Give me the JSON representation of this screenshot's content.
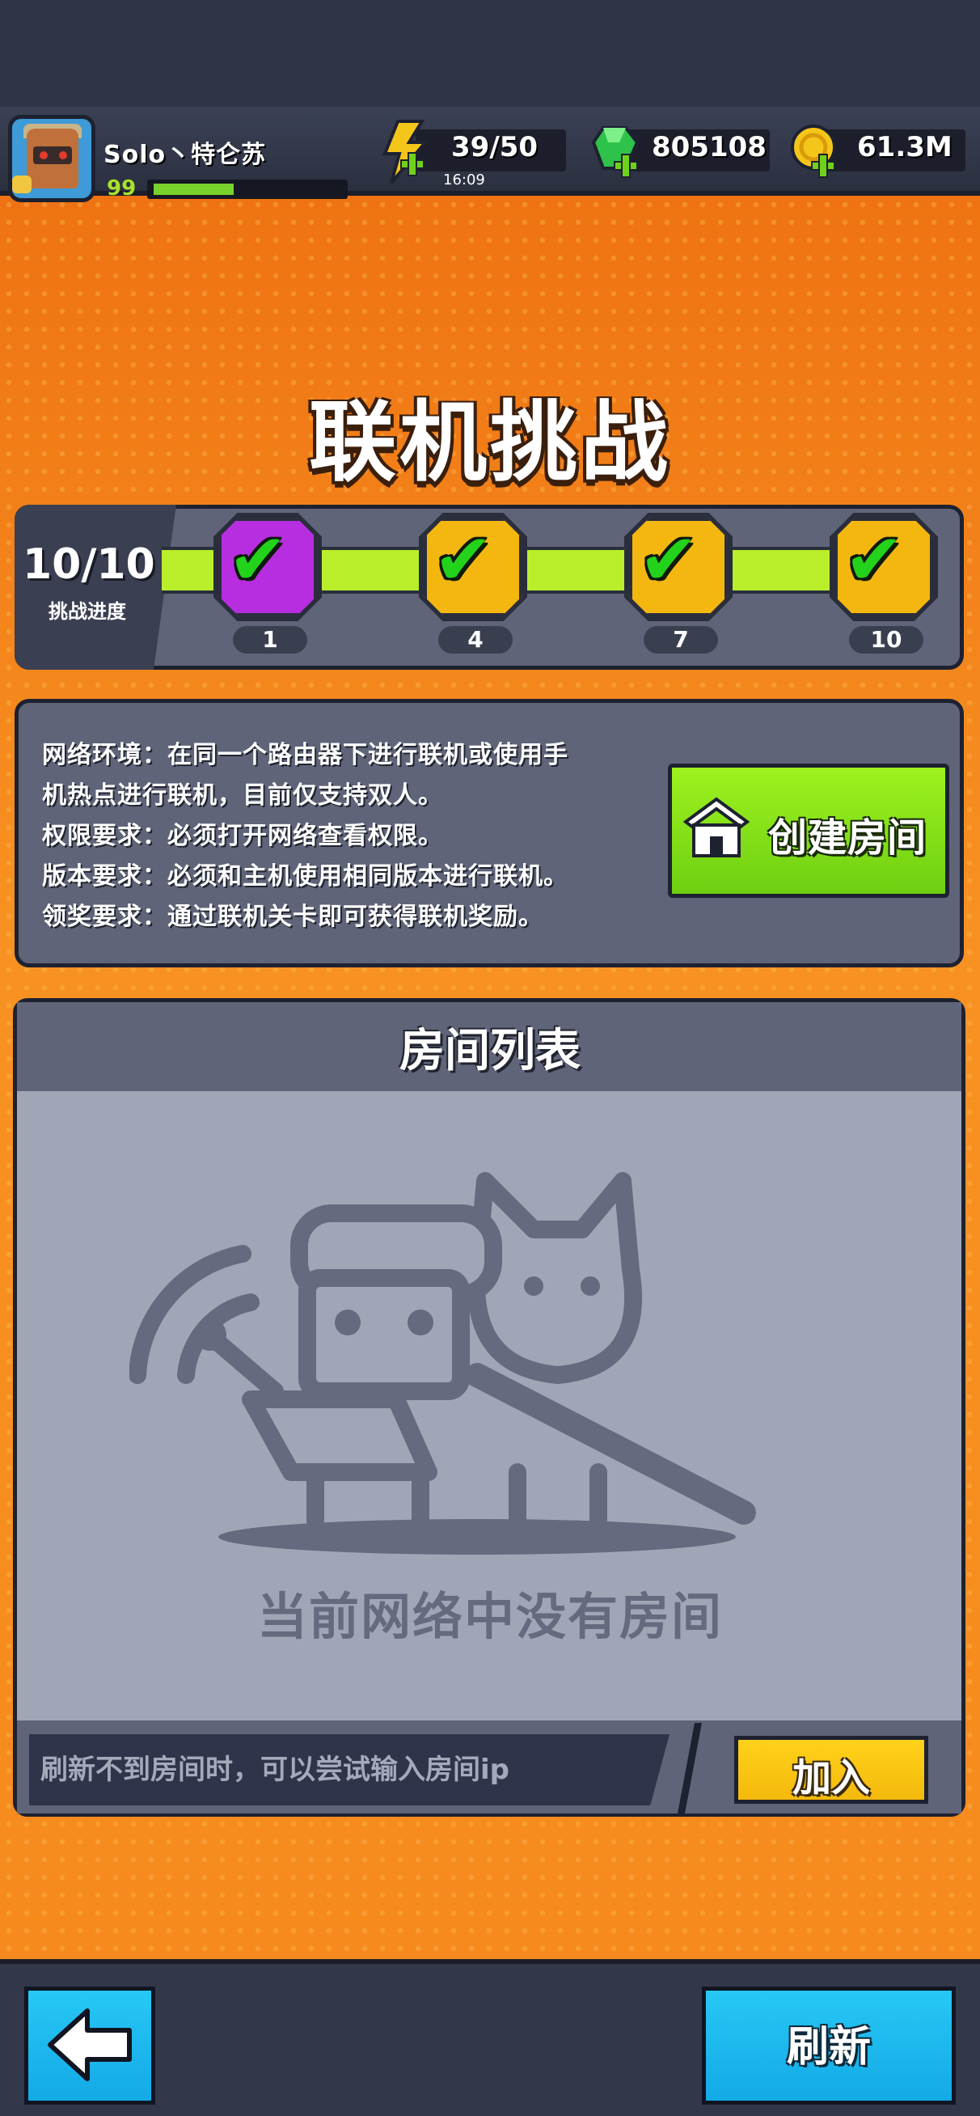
{
  "player": {
    "name": "Solo丶特仑苏",
    "level": "99",
    "xp_fraction": 0.42
  },
  "resources": {
    "energy": "39/50",
    "energy_timer": "16:09",
    "gems": "805108",
    "coins": "61.3M"
  },
  "page_title": "联机挑战",
  "challenge": {
    "count": "10/10",
    "label": "挑战进度",
    "milestones": [
      {
        "label": "1",
        "color": "#b72ee0"
      },
      {
        "label": "4",
        "color": "#f4b70f"
      },
      {
        "label": "7",
        "color": "#f4b70f"
      },
      {
        "label": "10",
        "color": "#f4b70f"
      }
    ]
  },
  "info": {
    "lines": [
      "网络环境：在同一个路由器下进行联机或使用手",
      "机热点进行联机，目前仅支持双人。",
      "权限要求：必须打开网络查看权限。",
      "版本要求：必须和主机使用相同版本进行联机。",
      "领奖要求：通过联机关卡即可获得联机奖励。"
    ],
    "create_button": "创建房间"
  },
  "rooms": {
    "title": "房间列表",
    "empty_message": "当前网络中没有房间",
    "ip_placeholder": "刷新不到房间时，可以尝试输入房间ip",
    "join_button": "加入"
  },
  "footer": {
    "refresh_button": "刷新"
  },
  "icons": {
    "energy": "lightning-icon",
    "gems": "gem-icon",
    "coins": "coin-icon",
    "create": "house-icon",
    "back": "arrow-left-icon",
    "check": "checkmark-icon"
  },
  "colors": {
    "accent_orange": "#f27a12",
    "panel": "#5f6479",
    "create_green": "#8ee51a",
    "join_yellow": "#f9c514",
    "button_blue": "#1cb8ef"
  }
}
